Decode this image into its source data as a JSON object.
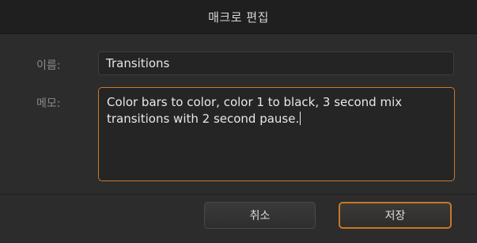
{
  "dialog": {
    "title": "매크로 편집",
    "name_label": "이름:",
    "name_value": "Transitions",
    "memo_label": "메모:",
    "memo_value": "Color bars to color, color 1 to black, 3 second mix transitions with 2 second pause.",
    "cancel_label": "취소",
    "save_label": "저장"
  },
  "colors": {
    "focus_accent": "#c8782a",
    "background": "#2c2c2c"
  }
}
